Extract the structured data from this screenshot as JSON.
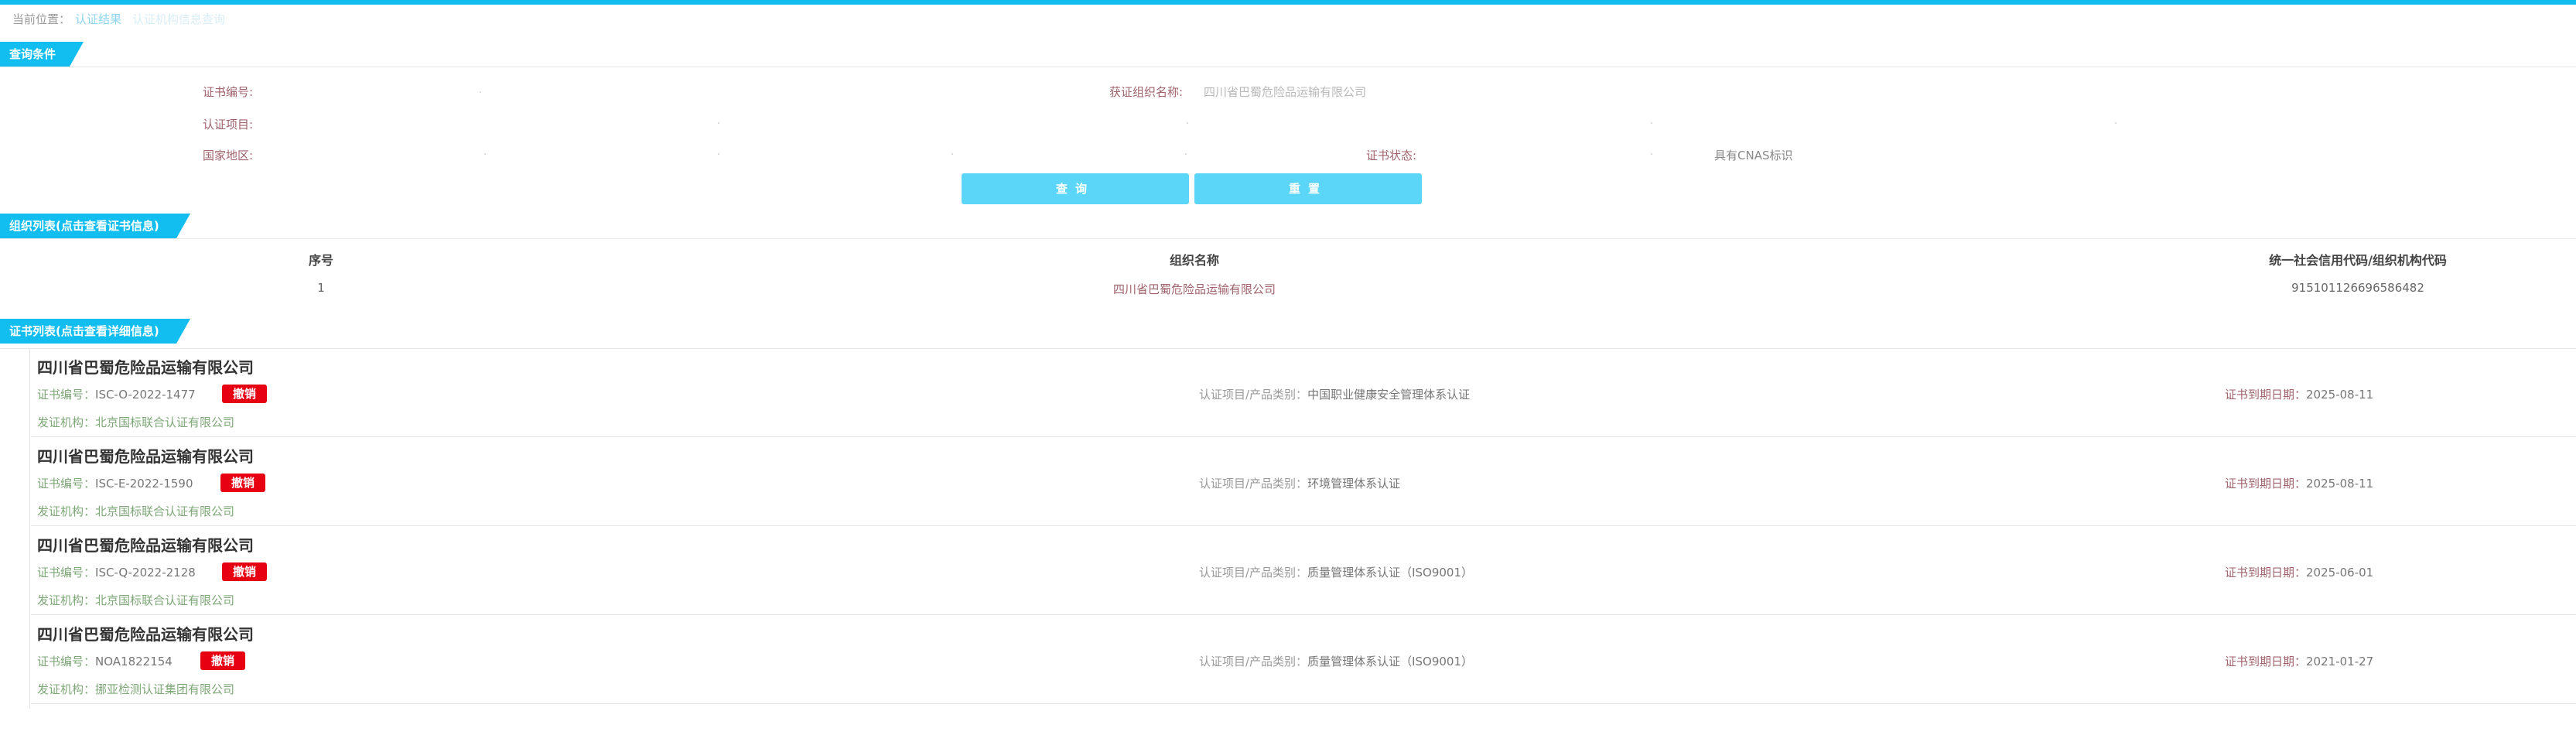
{
  "breadcrumb": {
    "label": "当前位置：",
    "link": "认证结果",
    "current": "认证机构信息查询"
  },
  "query": {
    "section_title": "查询条件",
    "cert_no_label": "证书编号:",
    "org_name_label": "获证组织名称:",
    "org_name_value": "四川省巴蜀危险品运输有限公司",
    "cert_item_label": "认证项目:",
    "country_label": "国家地区:",
    "status_label": "证书状态:",
    "cnas_label": "具有CNAS标识",
    "search_button": "查询",
    "reset_button": "重置"
  },
  "org_list": {
    "section_title": "组织列表(点击查看证书信息)",
    "columns": [
      "序号",
      "组织名称",
      "统一社会信用代码/组织机构代码"
    ],
    "rows": [
      [
        "1",
        "四川省巴蜀危险品运输有限公司",
        "915101126696586482"
      ]
    ]
  },
  "cert_list": {
    "section_title": "证书列表(点击查看详细信息)",
    "labels": {
      "cert_no": "证书编号：",
      "item": "认证项目/产品类别：",
      "expiry": "证书到期日期：",
      "issuer": "发证机构："
    },
    "items": [
      {
        "org": "四川省巴蜀危险品运输有限公司",
        "cert_no": "ISC-O-2022-1477",
        "status": "撤销",
        "item": "中国职业健康安全管理体系认证",
        "expiry": "2025-08-11",
        "issuer": "北京国标联合认证有限公司"
      },
      {
        "org": "四川省巴蜀危险品运输有限公司",
        "cert_no": "ISC-E-2022-1590",
        "status": "撤销",
        "item": "环境管理体系认证",
        "expiry": "2025-08-11",
        "issuer": "北京国标联合认证有限公司"
      },
      {
        "org": "四川省巴蜀危险品运输有限公司",
        "cert_no": "ISC-Q-2022-2128",
        "status": "撤销",
        "item": "质量管理体系认证（ISO9001）",
        "expiry": "2025-06-01",
        "issuer": "北京国标联合认证有限公司"
      },
      {
        "org": "四川省巴蜀危险品运输有限公司",
        "cert_no": "NOA1822154",
        "status": "撤销",
        "item": "质量管理体系认证（ISO9001）",
        "expiry": "2021-01-27",
        "issuer": "挪亚检测认证集团有限公司"
      }
    ]
  }
}
